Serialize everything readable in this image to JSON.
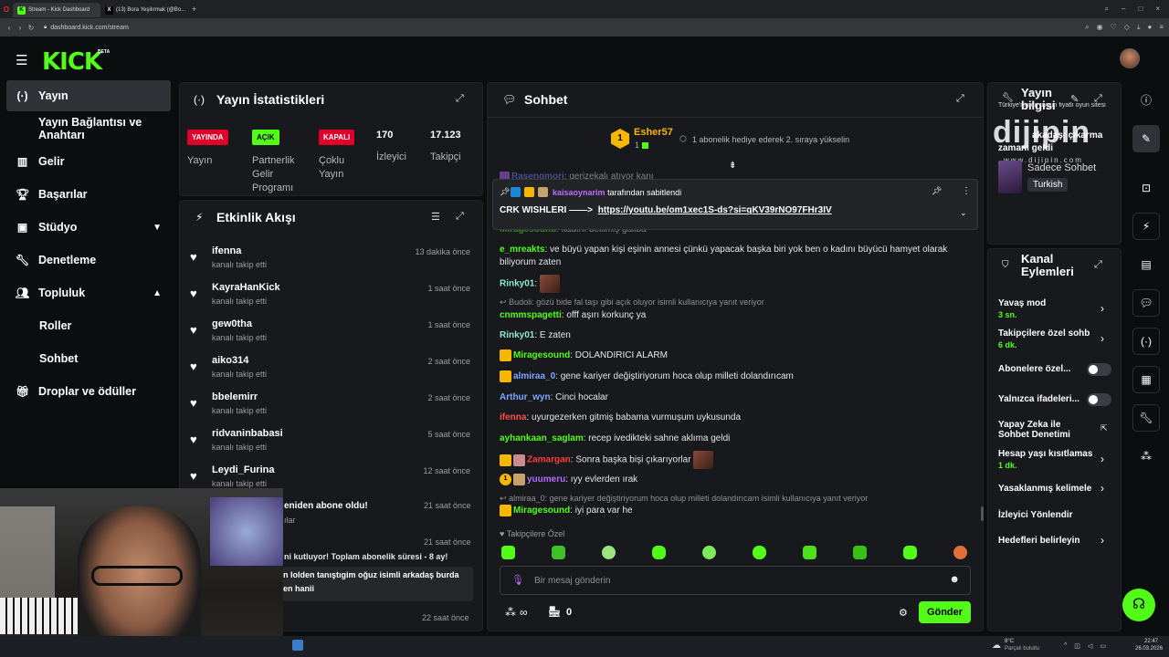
{
  "browser": {
    "tabs": [
      {
        "label": "Stream - Kick Dashboard",
        "active": true
      },
      {
        "label": "(13) Bora Yeşilırmak (@Bo...",
        "active": false
      }
    ],
    "url": "dashboard.kick.com/stream",
    "window_controls": [
      "–",
      "□",
      "×"
    ]
  },
  "header": {
    "logo": "KICK",
    "beta": "BETA"
  },
  "sidebar": {
    "items": [
      {
        "label": "Yayın",
        "icon": "broadcast-icon",
        "active": true
      },
      {
        "label": "Yayın Bağlantısı ve Anahtarı"
      },
      {
        "label": "Gelir",
        "icon": "chart-icon"
      },
      {
        "label": "Başarılar",
        "icon": "trophy-icon"
      },
      {
        "label": "Stüdyo",
        "icon": "studio-icon",
        "chevron": "down"
      },
      {
        "label": "Denetleme",
        "icon": "wrench-icon"
      },
      {
        "label": "Topluluk",
        "icon": "users-icon",
        "chevron": "up"
      },
      {
        "label": "Roller"
      },
      {
        "label": "Sohbet"
      },
      {
        "label": "Droplar ve ödüller",
        "icon": "gift-icon"
      }
    ]
  },
  "stats": {
    "title": "Yayın İstatistikleri",
    "live_badge": "YAYINDA",
    "live_label": "Yayın",
    "partner_badge": "AÇIK",
    "partner_label": "Partnerlik Gelir Programı",
    "multi_badge": "KAPALI",
    "multi_label": "Çoklu Yayın",
    "viewers_value": "170",
    "viewers_label": "İzleyici",
    "followers_value": "17.123",
    "followers_label": "Takipçi"
  },
  "activity": {
    "title": "Etkinlik Akışı",
    "items": [
      {
        "name": "ifenna",
        "action": "kanalı takip etti",
        "time": "13 dakika önce"
      },
      {
        "name": "KayraHanKick",
        "action": "kanalı takip etti",
        "time": "1 saat önce"
      },
      {
        "name": "gew0tha",
        "action": "kanalı takip etti",
        "time": "1 saat önce"
      },
      {
        "name": "aiko314",
        "action": "kanalı takip etti",
        "time": "2 saat önce"
      },
      {
        "name": "bbelemirr",
        "action": "kanalı takip etti",
        "time": "2 saat önce"
      },
      {
        "name": "ridvaninbabasi",
        "action": "kanalı takip etti",
        "time": "5 saat önce"
      },
      {
        "name": "Leydi_Furina",
        "action": "kanalı takip etti",
        "time": "12 saat önce"
      }
    ],
    "partial": [
      {
        "text": "eniden abone oldu!",
        "time": "21 saat önce"
      },
      {
        "text": "ılar",
        "time": ""
      },
      {
        "text": "ni kutluyor! Toplam abonelik süresi - 8 ay!",
        "time": "21 saat önce"
      },
      {
        "text": "n lolden tanıştıgim oğuz isimli arkadaş burda",
        "time": ""
      },
      {
        "text": "en hanii",
        "time": ""
      },
      {
        "text": "",
        "time": "22 saat önce"
      }
    ]
  },
  "chat": {
    "title": "Sohbet",
    "gifter_rank": "1",
    "gifter_name": "Esher57",
    "gifter_count": "1",
    "gift_prompt": "1 abonelik hediye ederek 2. sıraya yükselin",
    "pinned": {
      "pinner": "kaisaoynarim",
      "pinned_text": "tarafından sabitlendi",
      "message_prefix": "CRK WISHLERI ——>",
      "link": "https://youtu.be/om1xec1S-ds?si=qKV39rNO97FHr3IV"
    },
    "messages": [
      {
        "user": "Rasengmori",
        "text": "gerizekalı atıyor kanı",
        "color": "#7e7eff"
      },
      {
        "user": "Miragesound",
        "text": "kadını delilmiş galiba",
        "color": "#53fc18"
      },
      {
        "user": "e_mreakts",
        "text": "ve büyü yapan kişi eşinin annesi çünkü yapacak başka biri yok ben o kadını büyücü hamyet olarak biliyorum zaten",
        "color": "#53fc18"
      },
      {
        "user": "Rinky01",
        "text": "",
        "color": "#8ce9c8"
      },
      {
        "reply": "Budoli: gözü bide fal taşı gibi açık oluyor isimli kullanıcıya yanıt veriyor"
      },
      {
        "user": "cnmmspagetti",
        "text": "offf aşırı korkunç ya",
        "color": "#53fc18"
      },
      {
        "user": "Rinky01",
        "text": "E zaten",
        "color": "#8ce9c8"
      },
      {
        "user": "Miragesound",
        "text": "DOLANDIRICI ALARM",
        "color": "#53fc18"
      },
      {
        "user": "almiraa_0",
        "text": "gene kariyer değiştiriyorum hoca olup milleti dolandırıcam",
        "color": "#7aa7ff"
      },
      {
        "user": "Arthur_wyn",
        "text": "Cinci hocalar",
        "color": "#7aa7ff"
      },
      {
        "user": "ifenna",
        "text": "uyurgezerken gitmiş babama vurmuşum uykusunda",
        "color": "#ff4d4d"
      },
      {
        "user": "ayhankaan_saglam",
        "text": "recep ivedikteki sahne aklıma geldi",
        "color": "#53fc18"
      },
      {
        "user": "Zamargan",
        "text": "Sonra başka bişi çıkarıyorlar",
        "color": "#ff3b3b"
      },
      {
        "user": "yuumeru",
        "text": "ıyy evlerden ırak",
        "color": "#b36cff"
      },
      {
        "reply": "almiraa_0: gene kariyer değiştiriyorum hoca olup milleti dolandırıcam isimli kullanıcıya yanıt veriyor"
      },
      {
        "user": "Miragesound",
        "text": "iyi para var he",
        "color": "#53fc18"
      }
    ],
    "followers_only": "Takipçilere Özel",
    "input_placeholder": "Bir mesaj gönderin",
    "points": "∞",
    "store_count": "0",
    "send_label": "Gönder"
  },
  "stream_info": {
    "title": "Yayın bilgisi",
    "line1": "Türkiye'nin en uygun fiyatlı oyun sitesi",
    "line2": "akadaşı çıkarma",
    "line3": "zamanı geldi",
    "category": "Sadece Sohbet",
    "language": "Turkish",
    "watermark": "dijipin",
    "watermark_url": "www.dijipin.com"
  },
  "channel_actions": {
    "title": "Kanal Eylemleri",
    "items": [
      {
        "label": "Yavaş mod",
        "value": "3 sn.",
        "control": "arrow"
      },
      {
        "label": "Takipçilere özel sohb",
        "value": "6 dk.",
        "control": "arrow"
      },
      {
        "label": "Abonelere özel...",
        "value": "",
        "control": "toggle"
      },
      {
        "label": "Yalnızca ifadeleri...",
        "value": "",
        "control": "toggle"
      },
      {
        "label": "Yapay Zeka ile Sohbet Denetimi",
        "value": "",
        "control": "external"
      },
      {
        "label": "Hesap yaşı kısıtlamas",
        "value": "1 dk.",
        "control": "arrow"
      },
      {
        "label": "Yasaklanmış kelimele",
        "value": "",
        "control": "arrow"
      },
      {
        "label": "İzleyici Yönlendir",
        "value": "",
        "control": "none"
      },
      {
        "label": "Hedefleri belirleyin",
        "value": "",
        "control": "arrow"
      }
    ]
  },
  "taskbar": {
    "weather": "8°C",
    "weather_desc": "Parçalı bulutlu",
    "time": "22:47",
    "date": "26.03.2026"
  },
  "colors": {
    "kick_green": "#53fc18",
    "panel": "#18191c",
    "bg": "#0b0e0f",
    "live_red": "#e0002a"
  }
}
